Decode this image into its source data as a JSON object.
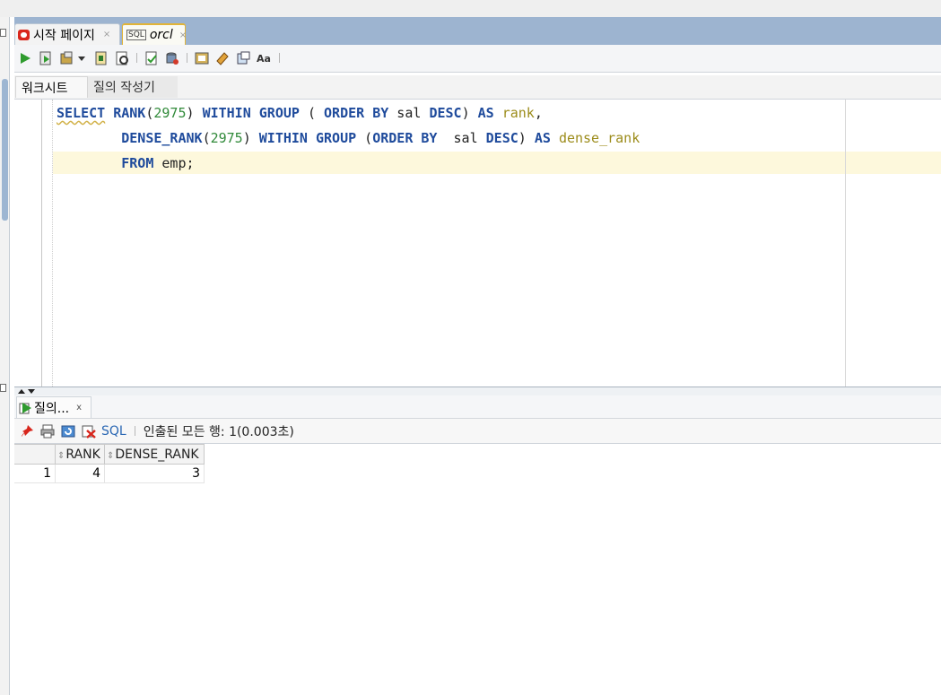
{
  "tabs": {
    "start_page": "시작 페이지",
    "connection": "orcl",
    "close_glyph": "×"
  },
  "worksheet_tabs": {
    "worksheet": "워크시트",
    "query_builder": "질의 작성기"
  },
  "sql_lines": [
    [
      {
        "t": "SELECT",
        "c": "kw",
        "squig": true
      },
      {
        "t": " "
      },
      {
        "t": "RANK",
        "c": "kw"
      },
      {
        "t": "(",
        "c": "plain"
      },
      {
        "t": "2975",
        "c": "num"
      },
      {
        "t": ") ",
        "c": "plain"
      },
      {
        "t": "WITHIN",
        "c": "kw"
      },
      {
        "t": " "
      },
      {
        "t": "GROUP",
        "c": "kw"
      },
      {
        "t": " ( ",
        "c": "plain"
      },
      {
        "t": "ORDER",
        "c": "kw"
      },
      {
        "t": " "
      },
      {
        "t": "BY",
        "c": "kw"
      },
      {
        "t": " sal ",
        "c": "plain"
      },
      {
        "t": "DESC",
        "c": "kw"
      },
      {
        "t": ") ",
        "c": "plain"
      },
      {
        "t": "AS",
        "c": "kw"
      },
      {
        "t": " "
      },
      {
        "t": "rank",
        "c": "alias"
      },
      {
        "t": ",",
        "c": "plain"
      }
    ],
    [
      {
        "t": "        "
      },
      {
        "t": "DENSE_RANK",
        "c": "kw"
      },
      {
        "t": "(",
        "c": "plain"
      },
      {
        "t": "2975",
        "c": "num"
      },
      {
        "t": ") ",
        "c": "plain"
      },
      {
        "t": "WITHIN",
        "c": "kw"
      },
      {
        "t": " "
      },
      {
        "t": "GROUP",
        "c": "kw"
      },
      {
        "t": " (",
        "c": "plain"
      },
      {
        "t": "ORDER",
        "c": "kw"
      },
      {
        "t": " "
      },
      {
        "t": "BY",
        "c": "kw"
      },
      {
        "t": "  sal ",
        "c": "plain"
      },
      {
        "t": "DESC",
        "c": "kw"
      },
      {
        "t": ") ",
        "c": "plain"
      },
      {
        "t": "AS",
        "c": "kw"
      },
      {
        "t": " "
      },
      {
        "t": "dense_rank",
        "c": "alias"
      }
    ],
    [
      {
        "t": "        "
      },
      {
        "t": "FROM",
        "c": "kw"
      },
      {
        "t": " emp;",
        "c": "plain"
      }
    ]
  ],
  "results": {
    "tab_label": "질의...",
    "close_glyph": "x",
    "sql_link": "SQL",
    "status": "인출된 모든 행: 1(0.003초)",
    "columns": [
      "RANK",
      "DENSE_RANK"
    ],
    "rows": [
      {
        "num": "1",
        "cells": [
          "4",
          "3"
        ]
      }
    ]
  },
  "colors": {
    "tab_bar": "#9db4d0",
    "keyword": "#1f4b9c",
    "number": "#318a3a",
    "alias": "#9c8c1b",
    "current_line": "#fdf8dc"
  },
  "icons": {
    "toolbar": [
      "run-statement-icon",
      "run-script-icon",
      "commit-icon",
      "dropdown-icon",
      "autotrace-icon",
      "explain-plan-icon",
      "tuning-icon",
      "sql-history-icon",
      "db-monitor-icon",
      "eraser-icon",
      "sql-worksheet-icon",
      "format-case-icon"
    ],
    "results": [
      "pin-icon",
      "print-icon",
      "refresh-icon",
      "clear-icon"
    ]
  }
}
